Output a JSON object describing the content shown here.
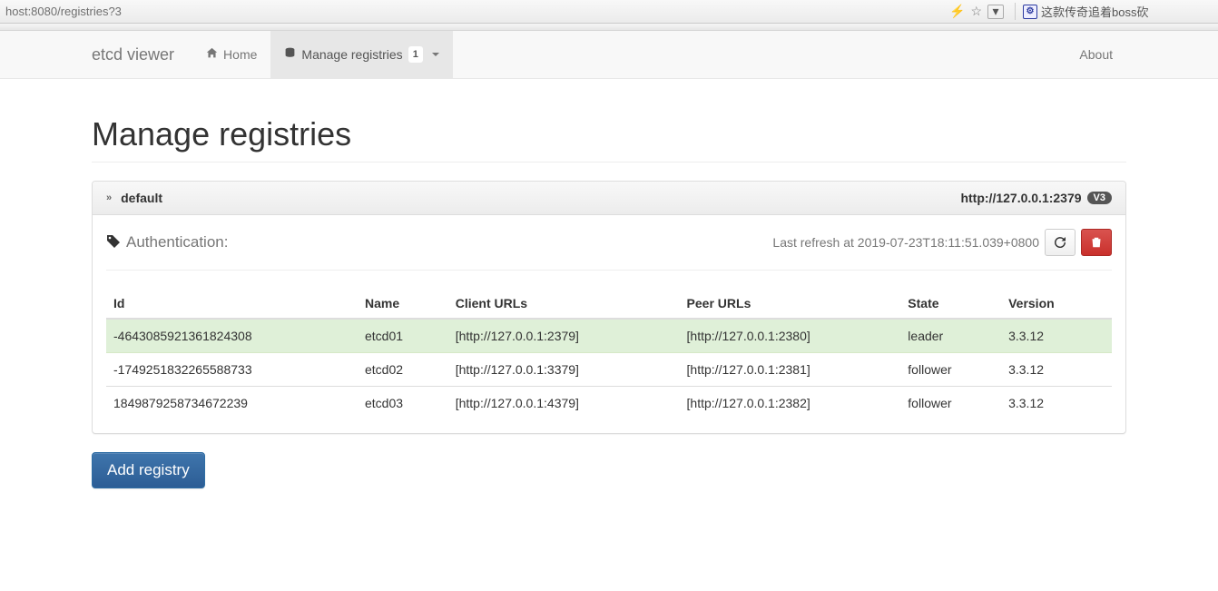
{
  "browser": {
    "url": "host:8080/registries?3",
    "extension_text": "这款传奇追着boss砍"
  },
  "navbar": {
    "brand": "etcd viewer",
    "home": "Home",
    "manage": "Manage registries",
    "badge": "1",
    "about": "About"
  },
  "page": {
    "title": "Manage registries"
  },
  "panel": {
    "name": "default",
    "url": "http://127.0.0.1:2379",
    "version_badge": "V3",
    "auth_label": "Authentication:",
    "refresh_text": "Last refresh at 2019-07-23T18:11:51.039+0800"
  },
  "table": {
    "headers": {
      "id": "Id",
      "name": "Name",
      "client_urls": "Client URLs",
      "peer_urls": "Peer URLs",
      "state": "State",
      "version": "Version"
    },
    "rows": [
      {
        "id": "-4643085921361824308",
        "name": "etcd01",
        "client_urls": "[http://127.0.0.1:2379]",
        "peer_urls": "[http://127.0.0.1:2380]",
        "state": "leader",
        "version": "3.3.12"
      },
      {
        "id": "-1749251832265588733",
        "name": "etcd02",
        "client_urls": "[http://127.0.0.1:3379]",
        "peer_urls": "[http://127.0.0.1:2381]",
        "state": "follower",
        "version": "3.3.12"
      },
      {
        "id": "1849879258734672239",
        "name": "etcd03",
        "client_urls": "[http://127.0.0.1:4379]",
        "peer_urls": "[http://127.0.0.1:2382]",
        "state": "follower",
        "version": "3.3.12"
      }
    ]
  },
  "buttons": {
    "add_registry": "Add registry"
  }
}
